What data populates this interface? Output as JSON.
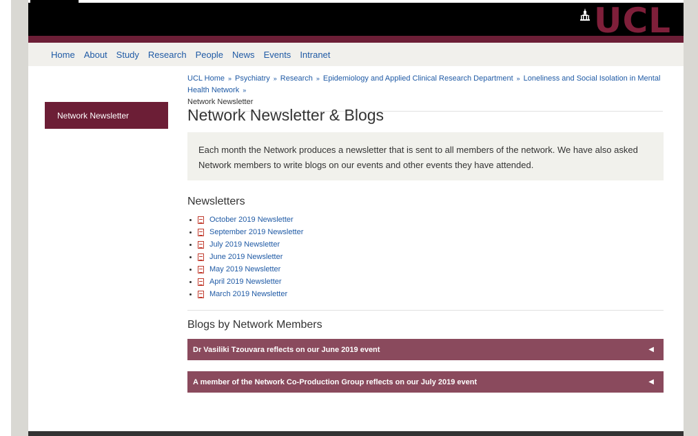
{
  "header": {
    "logo_text": "UCL",
    "brand_color": "#6c1e36"
  },
  "nav": {
    "items": [
      "Home",
      "About",
      "Study",
      "Research",
      "People",
      "News",
      "Events",
      "Intranet"
    ]
  },
  "breadcrumb": {
    "items": [
      "UCL Home",
      "Psychiatry",
      "Research",
      "Epidemiology and Applied Clinical Research Department",
      "Loneliness and Social Isolation in Mental Health Network"
    ],
    "current": "Network Newsletter"
  },
  "sidebar": {
    "items": [
      {
        "label": "Network Newsletter"
      }
    ]
  },
  "main": {
    "title": "Network Newsletter & Blogs",
    "intro": "Each month the Network produces a newsletter that is sent to all members of the network. We have also asked Network members to write blogs on our events and other events they have attended.",
    "newsletters_heading": "Newsletters",
    "newsletters": [
      "October 2019 Newsletter",
      "September 2019 Newsletter",
      "July 2019 Newsletter",
      "June 2019 Newsletter",
      "May 2019 Newsletter",
      "April 2019 Newsletter",
      "March 2019 Newsletter"
    ],
    "blogs_heading": "Blogs by Network Members",
    "blogs": [
      {
        "label": "Dr Vasiliki Tzouvara reflects on our June 2019 event",
        "icon": "triangle-left-icon"
      },
      {
        "label": "A member of the Network Co-Production Group reflects on our July 2019 event",
        "icon": "triangle-left-icon"
      }
    ]
  }
}
